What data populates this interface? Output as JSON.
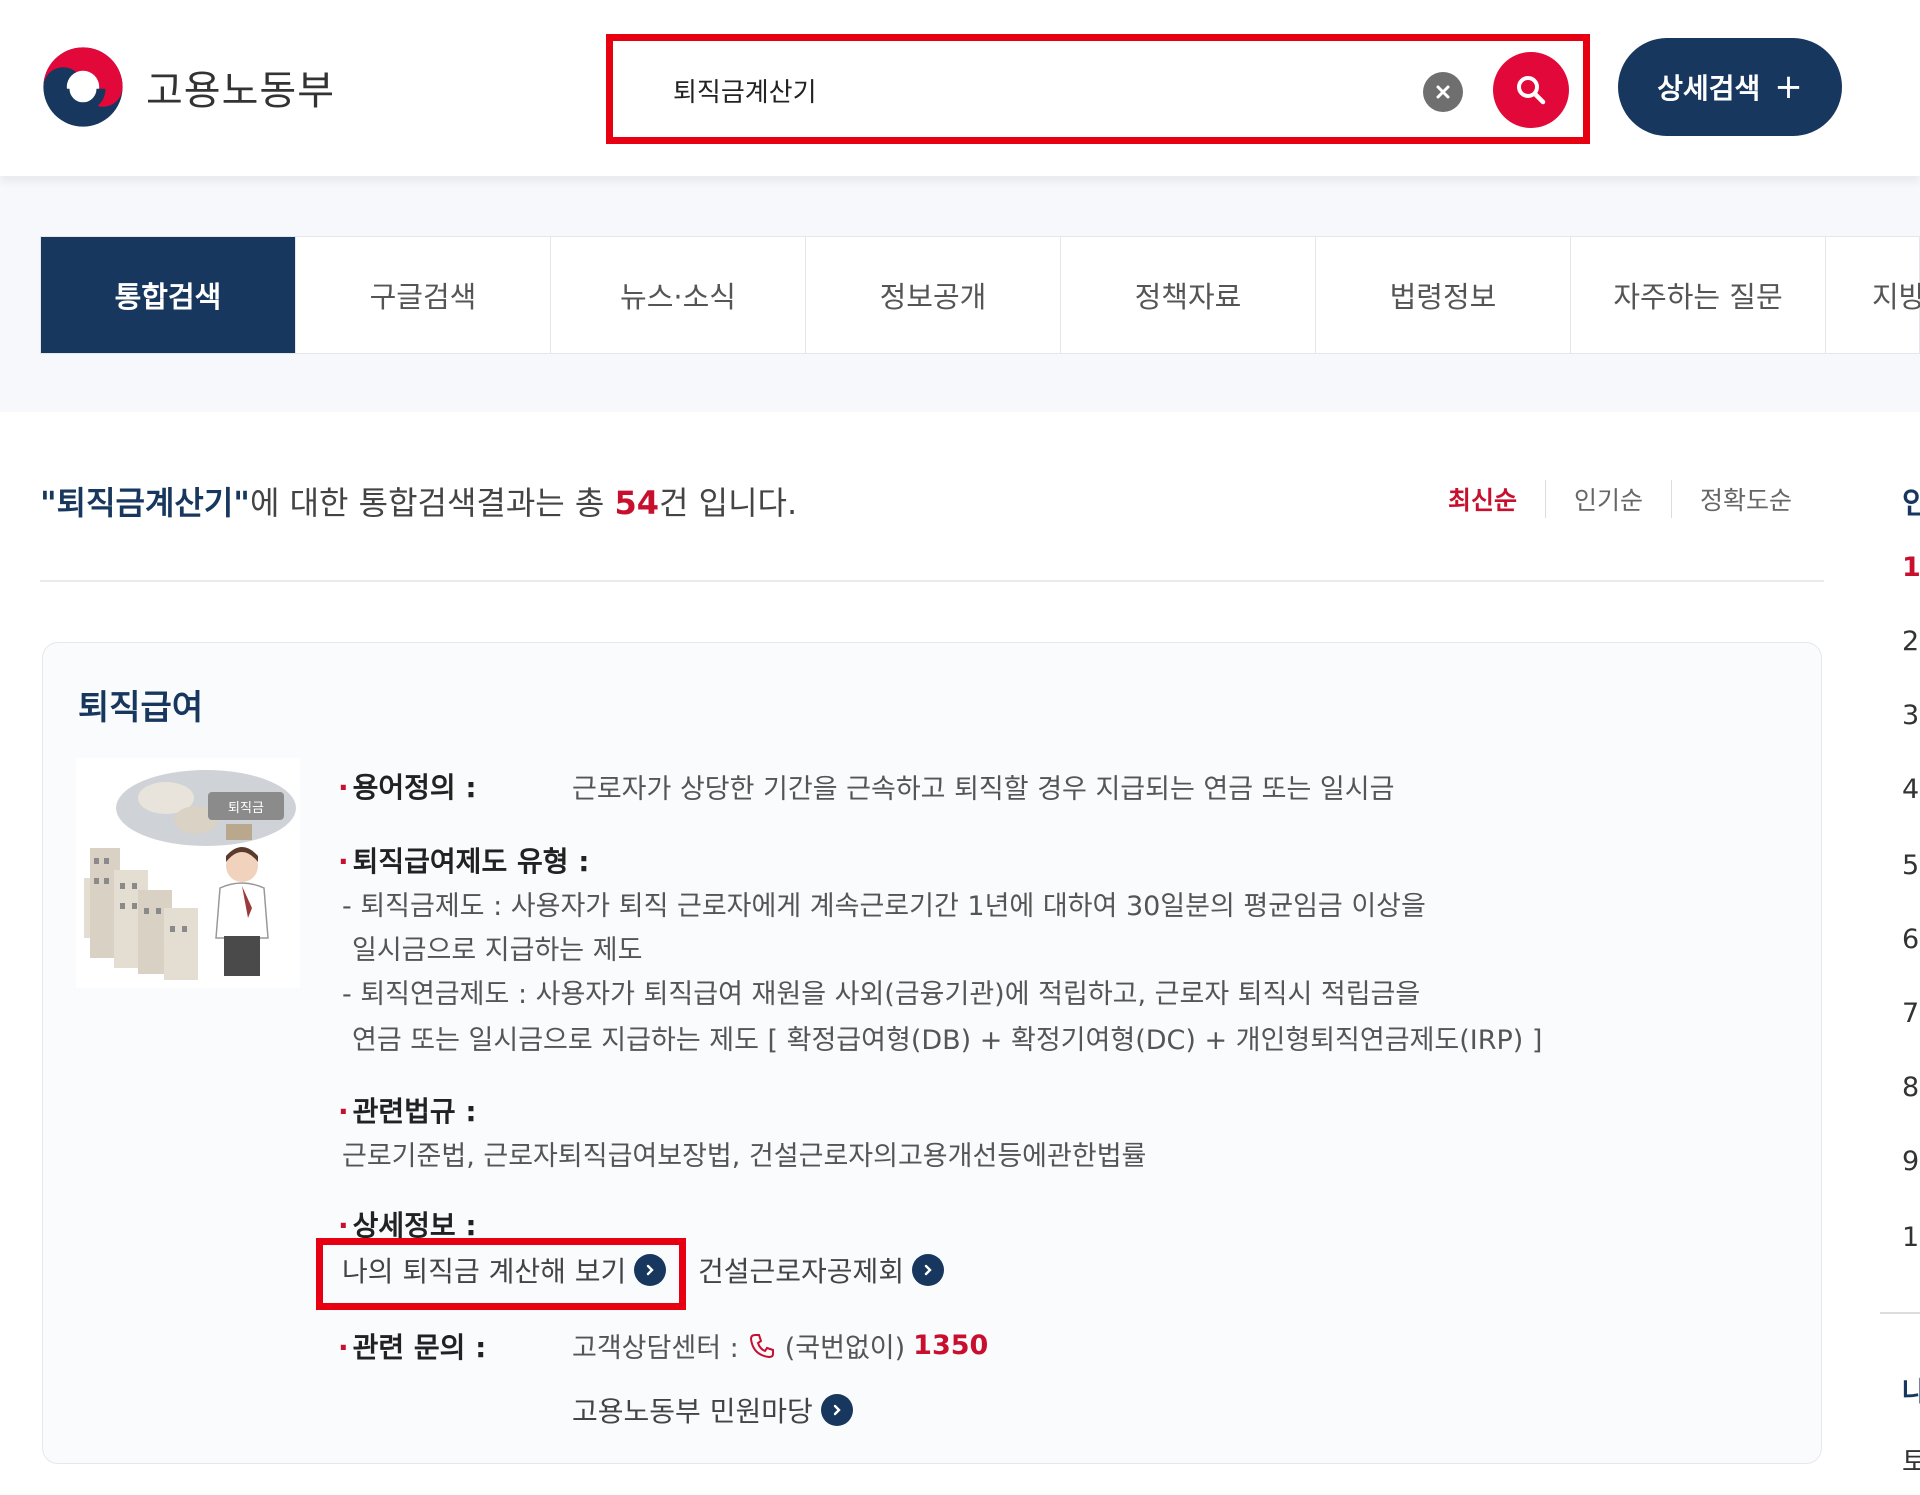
{
  "header": {
    "logo_text": "고용노동부",
    "search": {
      "value": "퇴직금계산기"
    },
    "advanced_search_label": "상세검색",
    "advanced_search_plus": "+"
  },
  "tabs": [
    "통합검색",
    "구글검색",
    "뉴스·소식",
    "정보공개",
    "정책자료",
    "법령정보",
    "자주하는 질문",
    "지방"
  ],
  "result": {
    "query": "\"퇴직금계산기\"",
    "text_mid": "에 대한 통합검색결과는 총 ",
    "count": "54",
    "text_end": "건 입니다."
  },
  "sort": {
    "items": [
      "최신순",
      "인기순",
      "정확도순"
    ],
    "active": "최신순"
  },
  "rank": {
    "title": "인",
    "numbers": [
      "1",
      "2",
      "3",
      "4",
      "5",
      "6",
      "7",
      "8",
      "9",
      "1"
    ],
    "bottom_label_1": "나",
    "bottom_label_2": "토"
  },
  "card": {
    "title": "퇴직급여",
    "illustration_badge": "퇴직금",
    "definition_label": "용어정의 :",
    "definition_text": "근로자가 상당한 기간을 근속하고 퇴직할 경우 지급되는 연금 또는 일시금",
    "types_label": "퇴직급여제도 유형 :",
    "types_lines": [
      "- 퇴직금제도 : 사용자가 퇴직 근로자에게 계속근로기간 1년에 대하여 30일분의 평균임금 이상을",
      "일시금으로 지급하는 제도",
      "- 퇴직연금제도 : 사용자가 퇴직급여 재원을 사외(금융기관)에 적립하고, 근로자 퇴직시 적립금을",
      "연금 또는 일시금으로 지급하는 제도 [ 확정급여형(DB) + 확정기여형(DC) + 개인형퇴직연금제도(IRP) ]"
    ],
    "laws_label": "관련법규 :",
    "laws_text": "근로기준법, 근로자퇴직급여보장법, 건설근로자의고용개선등에관한법률",
    "detail_label": "상세정보 :",
    "detail_links": [
      "나의 퇴직금 계산해 보기",
      "건설근로자공제회"
    ],
    "inquiry_label": "관련 문의 :",
    "inquiry_center": "고객상담센터 :",
    "inquiry_phone_prefix": "(국번없이)",
    "inquiry_phone_number": "1350",
    "inquiry_link": "고용노동부 민원마당"
  },
  "colors": {
    "navy": "#17375e",
    "red": "#c8102e",
    "highlight": "#e60012"
  }
}
